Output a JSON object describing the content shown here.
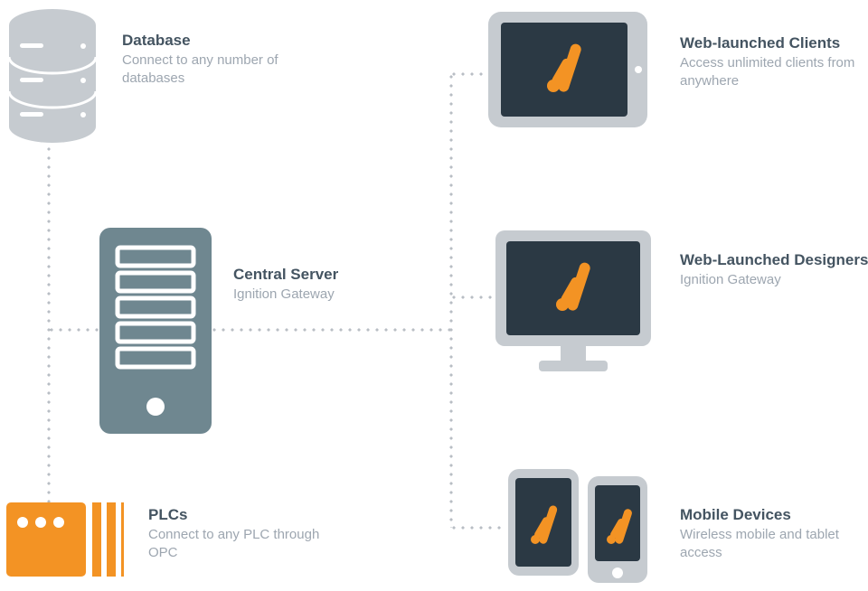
{
  "database": {
    "title": "Database",
    "desc": "Connect to any number of databases"
  },
  "central_server": {
    "title": "Central Server",
    "desc": "Ignition Gateway"
  },
  "plcs": {
    "title": "PLCs",
    "desc": "Connect to any PLC through OPC"
  },
  "web_clients": {
    "title": "Web-launched Clients",
    "desc": "Access unlimited clients from anywhere"
  },
  "web_designers": {
    "title": "Web-Launched Designers",
    "desc": "Ignition Gateway"
  },
  "mobile": {
    "title": "Mobile Devices",
    "desc": "Wireless mobile and tablet access"
  },
  "colors": {
    "dark": "#2b3944",
    "accent": "#f39324",
    "gray": "#c6cbd0",
    "teal": "#6f8790",
    "plc_orange": "#f39324"
  }
}
